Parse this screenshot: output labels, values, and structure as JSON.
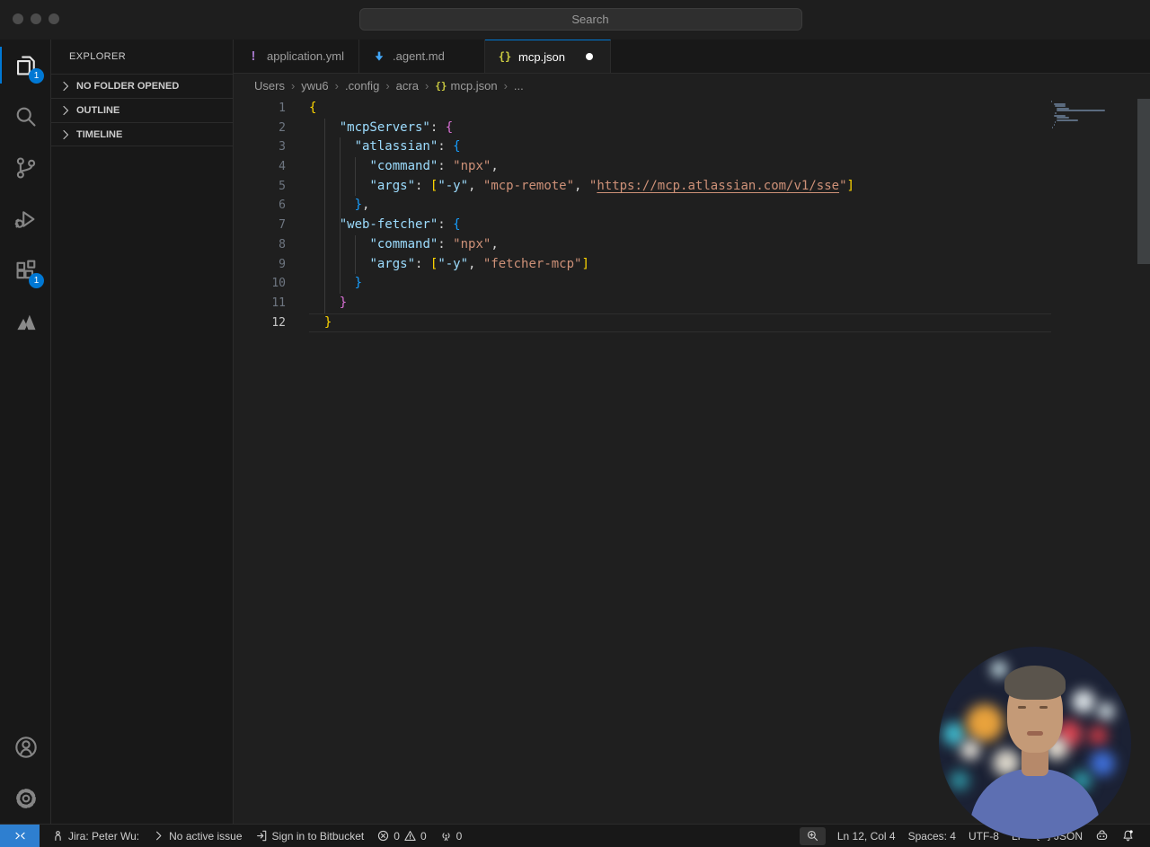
{
  "colors": {
    "accent": "#0078d4",
    "badge": "#0078d4",
    "yaml_icon": "#a074c4",
    "markdown_icon": "#42a5f5",
    "json_icon": "#cbcb41",
    "bracket_level1": "#ffd700",
    "bracket_level2": "#da70d6",
    "bracket_level3": "#179fff",
    "key_color": "#9cdcfe",
    "string_color": "#ce9178"
  },
  "titlebar": {
    "search_label": "Search",
    "traffic_lights": [
      "close",
      "minimize",
      "zoom"
    ]
  },
  "activity_bar": {
    "items": [
      {
        "id": "explorer",
        "icon": "files",
        "active": true,
        "badge": "1"
      },
      {
        "id": "search",
        "icon": "search",
        "active": false,
        "badge": ""
      },
      {
        "id": "source-control",
        "icon": "source-control",
        "active": false,
        "badge": ""
      },
      {
        "id": "run-debug",
        "icon": "debug",
        "active": false,
        "badge": ""
      },
      {
        "id": "extensions",
        "icon": "extensions",
        "active": false,
        "badge": "1"
      },
      {
        "id": "atlassian",
        "icon": "atlassian",
        "active": false,
        "badge": ""
      }
    ],
    "bottom": [
      {
        "id": "accounts",
        "icon": "account"
      },
      {
        "id": "settings",
        "icon": "gear"
      }
    ]
  },
  "sidebar": {
    "title": "EXPLORER",
    "sections": [
      {
        "label": "NO FOLDER OPENED"
      },
      {
        "label": "OUTLINE"
      },
      {
        "label": "TIMELINE"
      }
    ]
  },
  "editor": {
    "tabs": [
      {
        "label": "application.yml",
        "icon": "yaml",
        "active": false,
        "modified": false
      },
      {
        "label": ".agent.md",
        "icon": "markdown",
        "active": false,
        "modified": false
      },
      {
        "label": "mcp.json",
        "icon": "json",
        "active": true,
        "modified": true
      }
    ],
    "breadcrumb": [
      {
        "label": "Users"
      },
      {
        "label": "ywu6"
      },
      {
        "label": ".config"
      },
      {
        "label": "acra"
      },
      {
        "label": "mcp.json",
        "icon": "json"
      },
      {
        "label": "..."
      }
    ],
    "code": {
      "language": "json",
      "active_line": 12,
      "cursor": "Ln 12, Col 4",
      "lines": [
        [
          [
            "b1",
            "{"
          ]
        ],
        [
          [
            "p",
            "    "
          ],
          [
            "k",
            "\"mcpServers\""
          ],
          [
            "p",
            ": "
          ],
          [
            "b2",
            "{"
          ]
        ],
        [
          [
            "p",
            "      "
          ],
          [
            "k",
            "\"atlassian\""
          ],
          [
            "p",
            ": "
          ],
          [
            "b3",
            "{"
          ]
        ],
        [
          [
            "p",
            "        "
          ],
          [
            "k",
            "\"command\""
          ],
          [
            "p",
            ": "
          ],
          [
            "s",
            "\"npx\""
          ],
          [
            "p",
            ","
          ]
        ],
        [
          [
            "p",
            "        "
          ],
          [
            "k",
            "\"args\""
          ],
          [
            "p",
            ": "
          ],
          [
            "b1",
            "["
          ],
          [
            "k",
            "\"-y\""
          ],
          [
            "p",
            ", "
          ],
          [
            "s",
            "\"mcp-remote\""
          ],
          [
            "p",
            ", "
          ],
          [
            "s",
            "\""
          ],
          [
            "u",
            "https://mcp.atlassian.com/v1/sse"
          ],
          [
            "s",
            "\""
          ],
          [
            "b1",
            "]"
          ]
        ],
        [
          [
            "p",
            "      "
          ],
          [
            "b3",
            "}"
          ],
          [
            "p",
            ","
          ]
        ],
        [
          [
            "p",
            "    "
          ],
          [
            "k",
            "\"web-fetcher\""
          ],
          [
            "p",
            ": "
          ],
          [
            "b3",
            "{"
          ]
        ],
        [
          [
            "p",
            "        "
          ],
          [
            "k",
            "\"command\""
          ],
          [
            "p",
            ": "
          ],
          [
            "s",
            "\"npx\""
          ],
          [
            "p",
            ","
          ]
        ],
        [
          [
            "p",
            "        "
          ],
          [
            "k",
            "\"args\""
          ],
          [
            "p",
            ": "
          ],
          [
            "b1",
            "["
          ],
          [
            "k",
            "\"-y\""
          ],
          [
            "p",
            ", "
          ],
          [
            "s",
            "\"fetcher-mcp\""
          ],
          [
            "b1",
            "]"
          ]
        ],
        [
          [
            "p",
            "      "
          ],
          [
            "b3",
            "}"
          ]
        ],
        [
          [
            "p",
            "    "
          ],
          [
            "b2",
            "}"
          ]
        ],
        [
          [
            "p",
            "  "
          ],
          [
            "b1",
            "}"
          ]
        ]
      ],
      "guides": [
        {
          "col": 2,
          "from": 2,
          "to": 11
        },
        {
          "col": 4,
          "from": 3,
          "to": 10
        },
        {
          "col": 6,
          "from": 4,
          "to": 5
        },
        {
          "col": 6,
          "from": 8,
          "to": 9
        }
      ]
    }
  },
  "status_bar": {
    "left": [
      {
        "id": "remote-indicator",
        "cls": "remote",
        "parts": [
          {
            "icon": "remote"
          }
        ]
      },
      {
        "id": "jira-status",
        "cls": "",
        "parts": [
          {
            "icon": "person"
          },
          {
            "text": "Jira: Peter Wu:"
          }
        ]
      },
      {
        "id": "active-issue",
        "cls": "",
        "parts": [
          {
            "icon": "chevron-right"
          },
          {
            "text": "No active issue"
          }
        ]
      },
      {
        "id": "bitbucket-signin",
        "cls": "",
        "parts": [
          {
            "icon": "sign-in"
          },
          {
            "text": "Sign in to Bitbucket"
          }
        ]
      },
      {
        "id": "problems",
        "cls": "",
        "parts": [
          {
            "icon": "error"
          },
          {
            "text": "0"
          },
          {
            "icon": "warning"
          },
          {
            "text": "0"
          }
        ]
      },
      {
        "id": "ports",
        "cls": "",
        "parts": [
          {
            "icon": "broadcast"
          },
          {
            "text": "0"
          }
        ]
      }
    ],
    "right": [
      {
        "id": "zoom-level",
        "cls": "boxed",
        "parts": [
          {
            "icon": "zoom-in"
          }
        ]
      },
      {
        "id": "cursor-position",
        "cls": "",
        "parts": [
          {
            "text": "Ln 12, Col 4"
          }
        ]
      },
      {
        "id": "indentation",
        "cls": "",
        "parts": [
          {
            "text": "Spaces: 4"
          }
        ]
      },
      {
        "id": "encoding",
        "cls": "",
        "parts": [
          {
            "text": "UTF-8"
          }
        ]
      },
      {
        "id": "eol",
        "cls": "",
        "parts": [
          {
            "text": "LF"
          }
        ]
      },
      {
        "id": "language-mode",
        "cls": "",
        "parts": [
          {
            "icon": "braces"
          },
          {
            "text": "JSON"
          }
        ]
      },
      {
        "id": "copilot-status",
        "cls": "",
        "parts": [
          {
            "icon": "copilot"
          }
        ]
      },
      {
        "id": "notifications",
        "cls": "",
        "parts": [
          {
            "icon": "bell-dot"
          }
        ]
      }
    ]
  }
}
